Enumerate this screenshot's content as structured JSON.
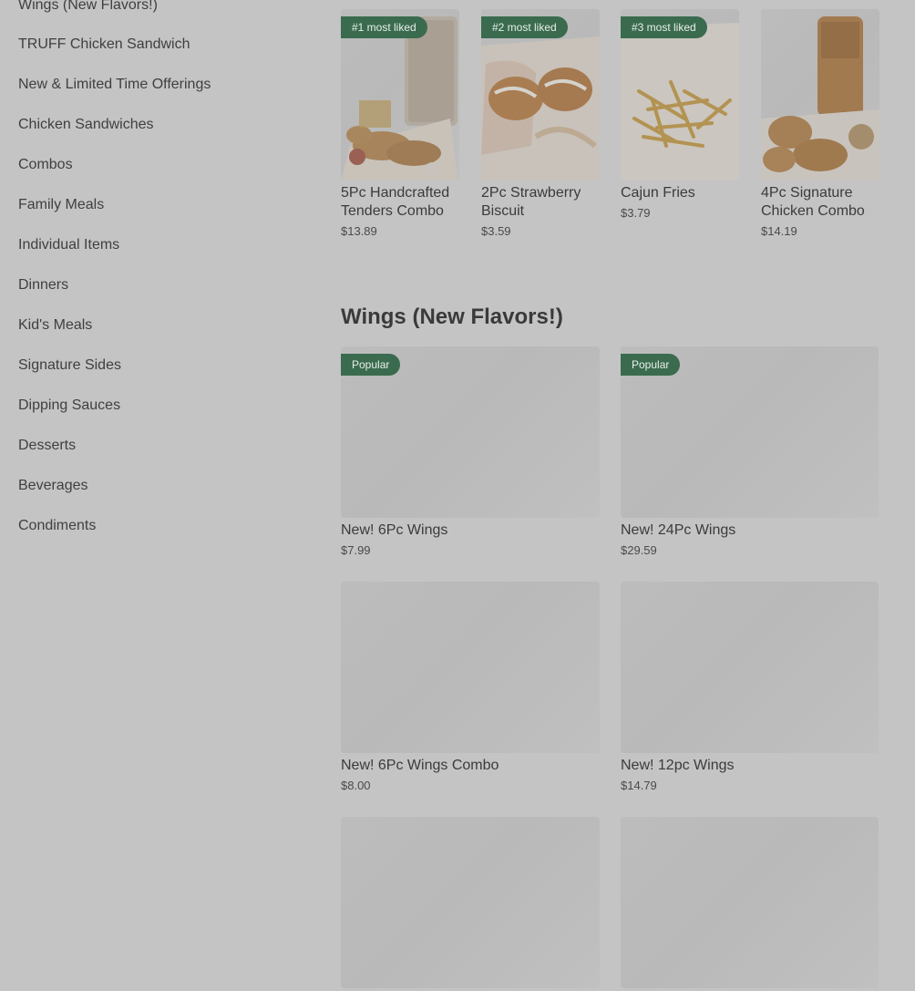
{
  "sidebar": {
    "items": [
      {
        "label": "Wings (New Flavors!)"
      },
      {
        "label": "TRUFF Chicken Sandwich"
      },
      {
        "label": "New & Limited Time Offerings"
      },
      {
        "label": "Chicken Sandwiches"
      },
      {
        "label": "Combos"
      },
      {
        "label": "Family Meals"
      },
      {
        "label": "Individual Items"
      },
      {
        "label": "Dinners"
      },
      {
        "label": "Kid's Meals"
      },
      {
        "label": "Signature Sides"
      },
      {
        "label": "Dipping Sauces"
      },
      {
        "label": "Desserts"
      },
      {
        "label": "Beverages"
      },
      {
        "label": "Condiments"
      }
    ]
  },
  "most_liked": [
    {
      "badge": "#1 most liked",
      "name": "5Pc Handcrafted Tenders Combo",
      "price": "$13.89",
      "image": "tenders-combo-image"
    },
    {
      "badge": "#2 most liked",
      "name": "2Pc Strawberry Biscuit",
      "price": "$3.59",
      "image": "strawberry-biscuit-image"
    },
    {
      "badge": "#3 most liked",
      "name": "Cajun Fries",
      "price": "$3.79",
      "image": "cajun-fries-image"
    },
    {
      "badge": "",
      "name": "4Pc Signature Chicken Combo",
      "price": "$14.19",
      "image": "signature-chicken-combo-image"
    }
  ],
  "wings_section": {
    "title": "Wings (New Flavors!)",
    "items": [
      {
        "badge": "Popular",
        "name": "New! 6Pc Wings",
        "price": "$7.99"
      },
      {
        "badge": "Popular",
        "name": "New! 24Pc Wings",
        "price": "$29.59"
      },
      {
        "badge": "",
        "name": "New! 6Pc Wings Combo",
        "price": "$8.00"
      },
      {
        "badge": "",
        "name": "New! 12pc Wings",
        "price": "$14.79"
      },
      {
        "badge": "",
        "name": "",
        "price": ""
      },
      {
        "badge": "",
        "name": "",
        "price": ""
      }
    ]
  },
  "colors": {
    "overlay_bg": "#c4c4c4",
    "badge_green": "#3a6b4f",
    "text": "#3a3a3a"
  }
}
